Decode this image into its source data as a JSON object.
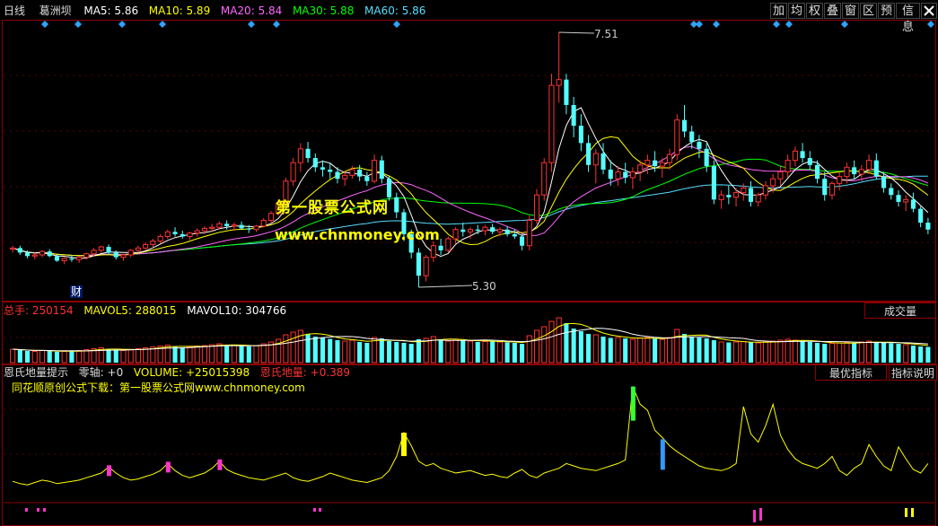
{
  "main_header": {
    "period": "日线",
    "stock_name": "葛洲坝",
    "ma5": {
      "label": "MA5: ",
      "value": "5.86",
      "color": "#ffffff"
    },
    "ma10": {
      "label": "MA10: ",
      "value": "5.89",
      "color": "#ffff00"
    },
    "ma20": {
      "label": "MA20: ",
      "value": "5.84",
      "color": "#ff66ff"
    },
    "ma30": {
      "label": "MA30: ",
      "value": "5.88",
      "color": "#00ff00"
    },
    "ma60": {
      "label": "MA60: ",
      "value": "5.86",
      "color": "#55ddff"
    }
  },
  "toolbar": {
    "buttons": [
      "加",
      "均",
      "权",
      "叠",
      "窗",
      "区",
      "预",
      "信息"
    ],
    "close_icon": "close-icon"
  },
  "price_annotations": {
    "high": "7.51",
    "low": "5.30",
    "finance_marker": "财"
  },
  "watermark": {
    "line1": "第一股票公式网",
    "line2": "www.chnmoney.com"
  },
  "volume_header": {
    "total_label": "总手: ",
    "total_value": "250154",
    "mavol5_label": "MAVOL5: ",
    "mavol5_value": "288015",
    "mavol10_label": "MAVOL10: ",
    "mavol10_value": "304766",
    "tab": "成交量"
  },
  "indicator_header": {
    "name": "恩氏地量提示",
    "zero_label": "零轴: ",
    "zero_value": "+0",
    "volume_label": "VOLUME: ",
    "volume_value": "+25015398",
    "dl_label": "恩氏地量: ",
    "dl_value": "+0.389",
    "subtitle": "同花顺原创公式下载：第一股票公式网www.chnmoney.com",
    "tab_best": "最优指标",
    "tab_help": "指标说明"
  },
  "colors": {
    "up": "#ff3232",
    "down": "#54ffff",
    "border": "#8b0000",
    "indicator_line": "#ffff00",
    "marker_pink": "#ff33cc",
    "marker_yellow": "#ffff00",
    "marker_green": "#33ff33",
    "marker_blue": "#3399ff"
  },
  "chart_data": [
    {
      "type": "candlestick",
      "price_high_label": 7.51,
      "price_low_label": 5.3,
      "candles": [
        [
          5.63,
          5.66,
          5.6,
          5.64
        ],
        [
          5.64,
          5.66,
          5.58,
          5.6
        ],
        [
          5.6,
          5.62,
          5.55,
          5.57
        ],
        [
          5.57,
          5.6,
          5.54,
          5.58
        ],
        [
          5.58,
          5.62,
          5.56,
          5.61
        ],
        [
          5.61,
          5.63,
          5.56,
          5.57
        ],
        [
          5.57,
          5.58,
          5.52,
          5.53
        ],
        [
          5.53,
          5.56,
          5.5,
          5.55
        ],
        [
          5.55,
          5.58,
          5.52,
          5.54
        ],
        [
          5.54,
          5.57,
          5.51,
          5.56
        ],
        [
          5.56,
          5.6,
          5.54,
          5.59
        ],
        [
          5.59,
          5.64,
          5.57,
          5.62
        ],
        [
          5.62,
          5.66,
          5.6,
          5.65
        ],
        [
          5.65,
          5.67,
          5.58,
          5.6
        ],
        [
          5.6,
          5.62,
          5.54,
          5.56
        ],
        [
          5.56,
          5.59,
          5.53,
          5.58
        ],
        [
          5.58,
          5.63,
          5.56,
          5.62
        ],
        [
          5.62,
          5.66,
          5.6,
          5.64
        ],
        [
          5.64,
          5.69,
          5.62,
          5.67
        ],
        [
          5.67,
          5.72,
          5.65,
          5.7
        ],
        [
          5.7,
          5.76,
          5.68,
          5.74
        ],
        [
          5.74,
          5.8,
          5.72,
          5.78
        ],
        [
          5.78,
          5.82,
          5.74,
          5.76
        ],
        [
          5.76,
          5.79,
          5.72,
          5.74
        ],
        [
          5.74,
          5.78,
          5.71,
          5.77
        ],
        [
          5.77,
          5.81,
          5.74,
          5.79
        ],
        [
          5.79,
          5.83,
          5.76,
          5.81
        ],
        [
          5.81,
          5.85,
          5.78,
          5.82
        ],
        [
          5.82,
          5.87,
          5.8,
          5.85
        ],
        [
          5.85,
          5.88,
          5.8,
          5.83
        ],
        [
          5.83,
          5.86,
          5.79,
          5.84
        ],
        [
          5.84,
          5.87,
          5.8,
          5.81
        ],
        [
          5.81,
          5.84,
          5.77,
          5.8
        ],
        [
          5.8,
          5.84,
          5.78,
          5.83
        ],
        [
          5.83,
          5.9,
          5.82,
          5.88
        ],
        [
          5.88,
          5.96,
          5.86,
          5.94
        ],
        [
          5.94,
          6.05,
          5.92,
          6.03
        ],
        [
          6.03,
          6.25,
          6.0,
          6.22
        ],
        [
          6.22,
          6.42,
          6.18,
          6.38
        ],
        [
          6.38,
          6.55,
          6.3,
          6.5
        ],
        [
          6.5,
          6.56,
          6.38,
          6.42
        ],
        [
          6.42,
          6.46,
          6.3,
          6.34
        ],
        [
          6.34,
          6.4,
          6.26,
          6.32
        ],
        [
          6.32,
          6.38,
          6.24,
          6.3
        ],
        [
          6.3,
          6.34,
          6.2,
          6.24
        ],
        [
          6.24,
          6.3,
          6.18,
          6.27
        ],
        [
          6.27,
          6.35,
          6.24,
          6.32
        ],
        [
          6.32,
          6.36,
          6.22,
          6.26
        ],
        [
          6.26,
          6.3,
          6.18,
          6.22
        ],
        [
          6.22,
          6.45,
          6.2,
          6.4
        ],
        [
          6.4,
          6.44,
          6.2,
          6.24
        ],
        [
          6.24,
          6.26,
          6.05,
          6.08
        ],
        [
          6.08,
          6.12,
          5.9,
          5.95
        ],
        [
          5.95,
          5.98,
          5.7,
          5.76
        ],
        [
          5.76,
          5.8,
          5.55,
          5.6
        ],
        [
          5.6,
          5.64,
          5.3,
          5.4
        ],
        [
          5.4,
          5.58,
          5.35,
          5.56
        ],
        [
          5.56,
          5.7,
          5.52,
          5.66
        ],
        [
          5.66,
          5.72,
          5.58,
          5.62
        ],
        [
          5.62,
          5.74,
          5.6,
          5.72
        ],
        [
          5.72,
          5.82,
          5.68,
          5.8
        ],
        [
          5.8,
          5.86,
          5.74,
          5.78
        ],
        [
          5.78,
          5.82,
          5.72,
          5.8
        ],
        [
          5.8,
          5.84,
          5.76,
          5.79
        ],
        [
          5.79,
          5.84,
          5.75,
          5.82
        ],
        [
          5.82,
          5.85,
          5.76,
          5.78
        ],
        [
          5.78,
          5.82,
          5.74,
          5.8
        ],
        [
          5.8,
          5.83,
          5.74,
          5.76
        ],
        [
          5.76,
          5.8,
          5.72,
          5.74
        ],
        [
          5.74,
          5.76,
          5.62,
          5.66
        ],
        [
          5.66,
          5.92,
          5.62,
          5.88
        ],
        [
          5.88,
          6.15,
          5.85,
          6.1
        ],
        [
          6.1,
          6.42,
          6.05,
          6.38
        ],
        [
          6.38,
          7.15,
          6.3,
          7.05
        ],
        [
          7.05,
          7.51,
          6.9,
          7.1
        ],
        [
          7.1,
          7.15,
          6.8,
          6.88
        ],
        [
          6.88,
          6.95,
          6.6,
          6.7
        ],
        [
          6.7,
          6.8,
          6.48,
          6.55
        ],
        [
          6.55,
          6.62,
          6.3,
          6.36
        ],
        [
          6.36,
          6.5,
          6.2,
          6.46
        ],
        [
          6.46,
          6.55,
          6.28,
          6.32
        ],
        [
          6.32,
          6.4,
          6.18,
          6.24
        ],
        [
          6.24,
          6.35,
          6.18,
          6.3
        ],
        [
          6.3,
          6.38,
          6.2,
          6.25
        ],
        [
          6.25,
          6.34,
          6.15,
          6.3
        ],
        [
          6.3,
          6.4,
          6.22,
          6.36
        ],
        [
          6.36,
          6.45,
          6.28,
          6.4
        ],
        [
          6.4,
          6.48,
          6.3,
          6.35
        ],
        [
          6.35,
          6.42,
          6.25,
          6.38
        ],
        [
          6.38,
          6.5,
          6.32,
          6.45
        ],
        [
          6.45,
          6.8,
          6.4,
          6.75
        ],
        [
          6.75,
          6.88,
          6.6,
          6.65
        ],
        [
          6.65,
          6.7,
          6.5,
          6.56
        ],
        [
          6.56,
          6.62,
          6.42,
          6.5
        ],
        [
          6.5,
          6.55,
          6.3,
          6.35
        ],
        [
          6.35,
          6.4,
          6.02,
          6.06
        ],
        [
          6.06,
          6.14,
          5.98,
          6.1
        ],
        [
          6.1,
          6.18,
          6.02,
          6.08
        ],
        [
          6.08,
          6.16,
          6.0,
          6.12
        ],
        [
          6.12,
          6.2,
          6.05,
          6.16
        ],
        [
          6.16,
          6.22,
          6.0,
          6.04
        ],
        [
          6.04,
          6.12,
          6.0,
          6.1
        ],
        [
          6.1,
          6.22,
          6.06,
          6.18
        ],
        [
          6.18,
          6.28,
          6.12,
          6.24
        ],
        [
          6.24,
          6.35,
          6.18,
          6.3
        ],
        [
          6.3,
          6.45,
          6.25,
          6.4
        ],
        [
          6.4,
          6.52,
          6.35,
          6.48
        ],
        [
          6.48,
          6.55,
          6.38,
          6.42
        ],
        [
          6.42,
          6.48,
          6.32,
          6.36
        ],
        [
          6.36,
          6.4,
          6.2,
          6.24
        ],
        [
          6.24,
          6.3,
          6.05,
          6.1
        ],
        [
          6.1,
          6.22,
          6.06,
          6.2
        ],
        [
          6.2,
          6.3,
          6.14,
          6.26
        ],
        [
          6.26,
          6.38,
          6.2,
          6.34
        ],
        [
          6.34,
          6.4,
          6.24,
          6.28
        ],
        [
          6.28,
          6.36,
          6.22,
          6.32
        ],
        [
          6.32,
          6.45,
          6.28,
          6.4
        ],
        [
          6.4,
          6.46,
          6.24,
          6.26
        ],
        [
          6.26,
          6.3,
          6.12,
          6.16
        ],
        [
          6.16,
          6.2,
          6.06,
          6.1
        ],
        [
          6.1,
          6.14,
          6.0,
          6.04
        ],
        [
          6.04,
          6.1,
          5.96,
          6.06
        ],
        [
          6.06,
          6.12,
          5.95,
          5.98
        ],
        [
          5.98,
          6.0,
          5.82,
          5.86
        ],
        [
          5.86,
          5.9,
          5.76,
          5.8
        ]
      ]
    },
    {
      "type": "bar",
      "name": "volume",
      "values": [
        30,
        28,
        26,
        25,
        27,
        26,
        24,
        25,
        26,
        27,
        29,
        31,
        33,
        30,
        28,
        27,
        29,
        31,
        33,
        35,
        37,
        39,
        36,
        34,
        35,
        37,
        38,
        40,
        42,
        39,
        38,
        37,
        36,
        38,
        42,
        46,
        52,
        62,
        68,
        72,
        64,
        58,
        55,
        53,
        50,
        48,
        50,
        46,
        44,
        56,
        54,
        48,
        46,
        44,
        42,
        52,
        54,
        58,
        50,
        48,
        52,
        50,
        48,
        46,
        47,
        48,
        46,
        45,
        44,
        42,
        60,
        72,
        80,
        92,
        100,
        88,
        76,
        70,
        64,
        62,
        58,
        55,
        56,
        54,
        52,
        55,
        56,
        54,
        52,
        56,
        74,
        64,
        58,
        56,
        54,
        50,
        46,
        45,
        46,
        47,
        45,
        44,
        46,
        48,
        50,
        52,
        50,
        48,
        46,
        44,
        42,
        43,
        44,
        45,
        44,
        46,
        48,
        46,
        44,
        43,
        42,
        40,
        38,
        36,
        35
      ]
    },
    {
      "type": "line",
      "name": "恩氏地量",
      "values": [
        0.15,
        0.13,
        0.12,
        0.14,
        0.16,
        0.15,
        0.13,
        0.14,
        0.15,
        0.16,
        0.18,
        0.2,
        0.22,
        0.27,
        0.22,
        0.18,
        0.16,
        0.17,
        0.19,
        0.21,
        0.24,
        0.3,
        0.24,
        0.2,
        0.18,
        0.2,
        0.22,
        0.26,
        0.32,
        0.25,
        0.22,
        0.2,
        0.18,
        0.17,
        0.16,
        0.18,
        0.2,
        0.22,
        0.18,
        0.16,
        0.15,
        0.17,
        0.19,
        0.22,
        0.2,
        0.18,
        0.16,
        0.15,
        0.14,
        0.16,
        0.18,
        0.24,
        0.36,
        0.56,
        0.45,
        0.32,
        0.28,
        0.3,
        0.26,
        0.24,
        0.22,
        0.23,
        0.24,
        0.22,
        0.2,
        0.21,
        0.19,
        0.18,
        0.22,
        0.25,
        0.2,
        0.18,
        0.22,
        0.24,
        0.26,
        0.3,
        0.28,
        0.26,
        0.25,
        0.24,
        0.26,
        0.28,
        0.3,
        0.33,
        0.95,
        0.8,
        0.75,
        0.58,
        0.52,
        0.45,
        0.4,
        0.36,
        0.32,
        0.28,
        0.26,
        0.25,
        0.24,
        0.26,
        0.3,
        0.78,
        0.55,
        0.48,
        0.62,
        0.8,
        0.54,
        0.42,
        0.34,
        0.3,
        0.28,
        0.26,
        0.3,
        0.36,
        0.24,
        0.2,
        0.26,
        0.3,
        0.46,
        0.36,
        0.28,
        0.24,
        0.44,
        0.34,
        0.25,
        0.22,
        0.3
      ],
      "markers_pink": [
        13,
        21,
        28
      ],
      "markers_yellow": [
        53
      ],
      "markers_green": [
        84
      ],
      "markers_blue": [
        88
      ]
    }
  ]
}
